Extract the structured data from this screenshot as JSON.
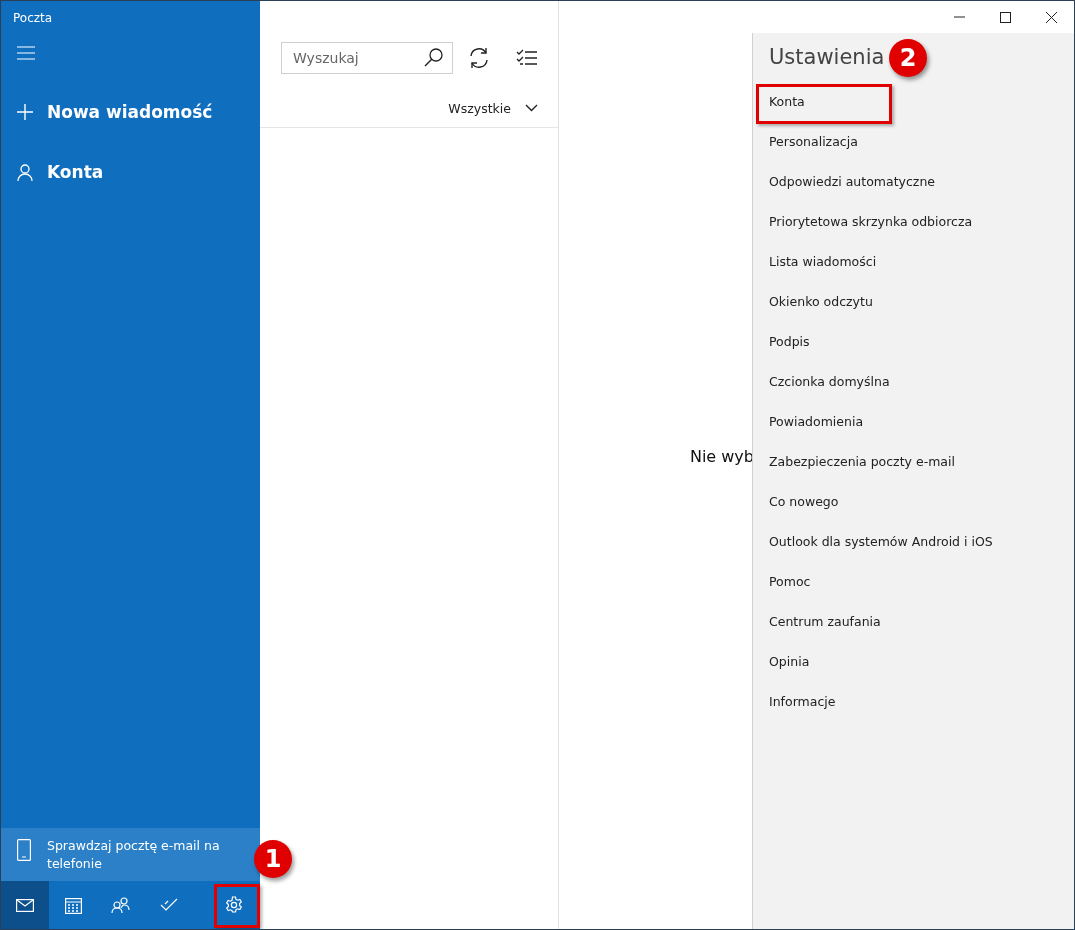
{
  "window": {
    "title": "Poczta"
  },
  "sidebar": {
    "new_message": "Nowa wiadomość",
    "accounts": "Konta",
    "promo": "Sprawdzaj pocztę e-mail na telefonie",
    "nav": [
      {
        "kind": "mail",
        "selected": true
      },
      {
        "kind": "calendar",
        "selected": false
      },
      {
        "kind": "people",
        "selected": false
      },
      {
        "kind": "todo",
        "selected": false
      },
      {
        "kind": "settings",
        "selected": false
      }
    ]
  },
  "message_list": {
    "search": {
      "placeholder": "Wyszukaj"
    },
    "filter": "Wszystkie"
  },
  "reading_pane": {
    "text": "Nie wyb"
  },
  "settings": {
    "title": "Ustawienia",
    "items": [
      "Konta",
      "Personalizacja",
      "Odpowiedzi automatyczne",
      "Priorytetowa skrzynka odbiorcza",
      "Lista wiadomości",
      "Okienko odczytu",
      "Podpis",
      "Czcionka domyślna",
      "Powiadomienia",
      "Zabezpieczenia poczty e-mail",
      "Co nowego",
      "Outlook dla systemów Android i iOS",
      "Pomoc",
      "Centrum zaufania",
      "Opinia",
      "Informacje"
    ]
  },
  "annotations": [
    {
      "label": "1"
    },
    {
      "label": "2"
    }
  ]
}
